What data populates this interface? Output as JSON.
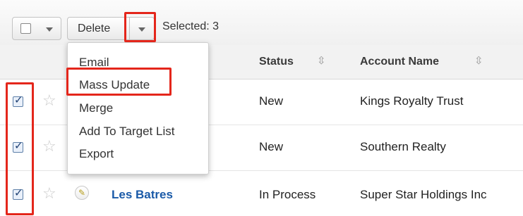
{
  "toolbar": {
    "delete_label": "Delete",
    "selected_label": "Selected: 3"
  },
  "table": {
    "columns": [
      {
        "label": "Status"
      },
      {
        "label": "Account Name"
      }
    ],
    "rows": [
      {
        "name": "",
        "status": "New",
        "account": "Kings Royalty Trust",
        "checked": true
      },
      {
        "name": "",
        "status": "New",
        "account": "Southern Realty",
        "checked": true
      },
      {
        "name": "Les Batres",
        "status": "In Process",
        "account": "Super Star Holdings Inc",
        "checked": true
      }
    ]
  },
  "menu": {
    "items": [
      {
        "label": "Email"
      },
      {
        "label": "Mass Update"
      },
      {
        "label": "Merge"
      },
      {
        "label": "Add To Target List"
      },
      {
        "label": "Export"
      }
    ]
  },
  "icons": {
    "sort": "sort-icon",
    "star": "star-icon",
    "edit": "pencil-icon",
    "caret": "chevron-down-icon"
  },
  "colors": {
    "highlight": "#e4261b",
    "link": "#1a5aa8"
  }
}
